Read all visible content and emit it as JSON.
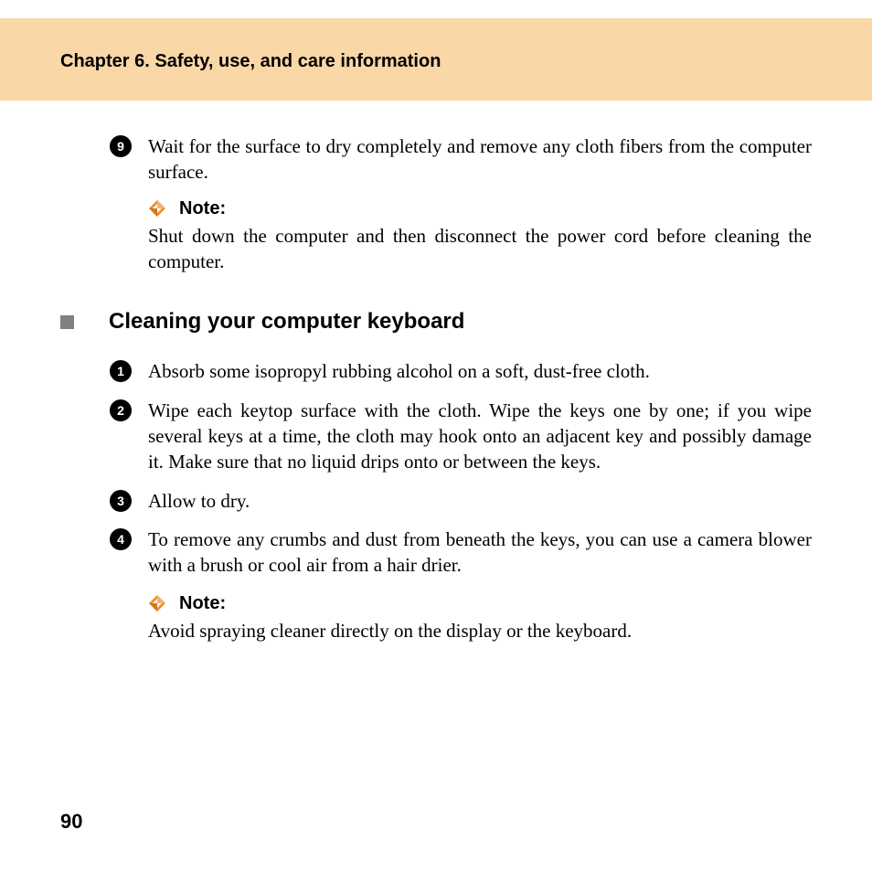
{
  "header": {
    "chapter_title": "Chapter 6. Safety, use, and care information"
  },
  "top_continued_step": {
    "num": "9",
    "text": "Wait for the surface to dry completely and remove any cloth fibers from the computer surface."
  },
  "note1": {
    "label": "Note:",
    "text": "Shut down the computer and then disconnect the power cord before cleaning the computer."
  },
  "section": {
    "heading": "Cleaning your computer keyboard"
  },
  "steps": [
    {
      "num": "1",
      "text": "Absorb some isopropyl rubbing alcohol on a soft, dust-free cloth."
    },
    {
      "num": "2",
      "text": "Wipe each keytop surface with the cloth. Wipe the keys one by one; if you wipe several keys at a time, the cloth may hook onto an adjacent key and possibly damage it. Make sure that no liquid drips onto or between the keys."
    },
    {
      "num": "3",
      "text": "Allow to dry."
    },
    {
      "num": "4",
      "text": "To remove any crumbs and dust from beneath the keys, you can use a camera blower with a brush or cool air from a hair drier."
    }
  ],
  "note2": {
    "label": "Note:",
    "text": "Avoid spraying cleaner directly on the display or the keyboard."
  },
  "page_number": "90"
}
